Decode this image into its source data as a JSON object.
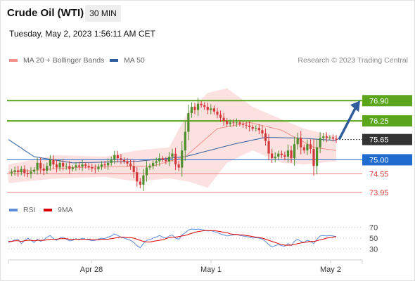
{
  "header": {
    "title": "Crude Oil (WTI)",
    "timeframe": "30 MIN",
    "datetime": "Tuesday, May 2, 2023 1:56:11 AM CET"
  },
  "legend": {
    "ma20": "MA 20 + Bollinger Bands",
    "ma50": "MA 50",
    "credit": "Research © 2023 Trading Central",
    "rsi": "RSI",
    "ma9": "9MA"
  },
  "colors": {
    "ma20": "#f4908a",
    "ma50": "#2f5c9a",
    "bollinger_fill": "#fbdcdc",
    "resistance": "#5aa51c",
    "pivot": "#1f6bd0",
    "support": "#ef7a7a",
    "current": "#333333",
    "candle_up": "#4d8f2a",
    "candle_down": "#d3393b",
    "rsi": "#5b8dd9",
    "rsi_ma": "#e00000"
  },
  "chart_data": [
    {
      "type": "candlestick",
      "ylim": [
        73.7,
        77.2
      ],
      "x_ticks": [
        "Apr 28",
        "May 1",
        "May 2"
      ],
      "levels": [
        {
          "label": "76.90",
          "value": 76.9,
          "role": "resistance"
        },
        {
          "label": "76.25",
          "value": 76.25,
          "role": "resistance"
        },
        {
          "label": "75.65",
          "value": 75.65,
          "role": "current"
        },
        {
          "label": "75.00",
          "value": 75.0,
          "role": "pivot"
        },
        {
          "label": "74.55",
          "value": 74.55,
          "role": "support"
        },
        {
          "label": "73.95",
          "value": 73.95,
          "role": "support"
        }
      ],
      "projection": {
        "from": 75.65,
        "to": 76.9
      },
      "price_path": [
        74.57,
        74.61,
        74.66,
        74.6,
        74.7,
        74.58,
        74.55,
        74.62,
        74.68,
        74.9,
        74.72,
        74.65,
        74.8,
        75.0,
        74.85,
        74.75,
        74.9,
        74.78,
        74.8,
        74.7,
        74.75,
        74.82,
        74.78,
        74.85,
        74.8,
        74.76,
        74.72,
        74.7,
        74.78,
        74.85,
        74.82,
        74.9,
        75.0,
        75.15,
        75.05,
        75.0,
        74.95,
        74.88,
        74.8,
        74.6,
        74.3,
        74.2,
        74.5,
        74.75,
        74.8,
        74.9,
        74.95,
        75.05,
        75.0,
        74.95,
        75.1,
        75.2,
        74.85,
        74.75,
        75.3,
        75.9,
        76.5,
        76.7,
        76.6,
        76.8,
        76.75,
        76.7,
        76.6,
        76.65,
        76.55,
        76.45,
        76.35,
        76.25,
        76.15,
        76.2,
        76.18,
        76.2,
        76.15,
        76.12,
        76.1,
        76.05,
        76.0,
        76.02,
        75.95,
        75.85,
        75.6,
        75.2,
        75.05,
        75.1,
        75.2,
        75.15,
        75.1,
        75.3,
        75.05,
        75.5,
        75.7,
        75.4,
        75.3,
        75.5,
        75.35,
        74.8,
        75.4,
        75.7,
        75.75,
        75.7,
        75.72,
        75.68,
        75.65
      ],
      "ma20": [
        [
          0,
          74.6
        ],
        [
          20,
          74.75
        ],
        [
          45,
          74.8
        ],
        [
          55,
          75.1
        ],
        [
          65,
          76.0
        ],
        [
          75,
          76.2
        ],
        [
          85,
          75.95
        ],
        [
          95,
          75.4
        ],
        [
          102,
          75.3
        ]
      ],
      "ma50": [
        [
          0,
          75.65
        ],
        [
          8,
          75.1
        ],
        [
          20,
          74.9
        ],
        [
          40,
          74.95
        ],
        [
          55,
          75.1
        ],
        [
          70,
          75.5
        ],
        [
          80,
          75.72
        ],
        [
          90,
          75.7
        ],
        [
          102,
          75.62
        ]
      ],
      "bollinger_upper": [
        [
          0,
          74.85
        ],
        [
          15,
          75.15
        ],
        [
          30,
          75.1
        ],
        [
          40,
          75.3
        ],
        [
          50,
          75.4
        ],
        [
          56,
          76.55
        ],
        [
          62,
          77.15
        ],
        [
          68,
          77.3
        ],
        [
          76,
          76.7
        ],
        [
          85,
          76.3
        ],
        [
          92,
          76.0
        ],
        [
          102,
          75.75
        ]
      ],
      "bollinger_lower": [
        [
          0,
          74.25
        ],
        [
          15,
          74.4
        ],
        [
          30,
          74.45
        ],
        [
          40,
          74.3
        ],
        [
          50,
          74.4
        ],
        [
          56,
          74.3
        ],
        [
          62,
          74.1
        ],
        [
          68,
          74.9
        ],
        [
          76,
          75.3
        ],
        [
          85,
          74.9
        ],
        [
          92,
          74.85
        ],
        [
          102,
          74.95
        ]
      ]
    },
    {
      "type": "line",
      "ylim": [
        20,
        80
      ],
      "y_ticks": [
        70,
        50,
        30
      ],
      "series": [
        {
          "name": "RSI",
          "values": [
            42,
            44,
            47,
            48,
            40,
            45,
            50,
            46,
            42,
            48,
            44,
            47,
            52,
            55,
            49,
            46,
            50,
            52,
            48,
            45,
            46,
            49,
            47,
            50,
            48,
            47,
            45,
            46,
            48,
            50,
            49,
            52,
            54,
            58,
            55,
            52,
            50,
            48,
            46,
            42,
            36,
            32,
            40,
            46,
            47,
            50,
            52,
            55,
            52,
            50,
            54,
            56,
            50,
            48,
            56,
            60,
            65,
            67,
            66,
            67,
            66,
            65,
            63,
            64,
            62,
            60,
            58,
            56,
            54,
            55,
            56,
            57,
            55,
            54,
            53,
            52,
            50,
            51,
            50,
            48,
            44,
            38,
            34,
            36,
            38,
            36,
            35,
            40,
            36,
            44,
            48,
            44,
            42,
            46,
            44,
            40,
            48,
            54,
            55,
            54,
            55,
            54,
            53
          ]
        },
        {
          "name": "9MA",
          "values": [
            44,
            44,
            45,
            45,
            44,
            45,
            46,
            46,
            45,
            46,
            46,
            46,
            47,
            48,
            48,
            48,
            49,
            49,
            49,
            48,
            48,
            48,
            48,
            48,
            48,
            48,
            47,
            47,
            47,
            48,
            48,
            48,
            49,
            50,
            51,
            52,
            52,
            51,
            51,
            50,
            48,
            46,
            44,
            43,
            43,
            44,
            45,
            46,
            47,
            49,
            51,
            52,
            52,
            53,
            54,
            55,
            57,
            59,
            61,
            62,
            63,
            64,
            64,
            64,
            64,
            63,
            62,
            61,
            60,
            58,
            57,
            57,
            56,
            56,
            55,
            54,
            53,
            52,
            51,
            50,
            48,
            46,
            44,
            42,
            40,
            38,
            37,
            37,
            37,
            38,
            40,
            41,
            42,
            43,
            44,
            44,
            45,
            47,
            48,
            50,
            51,
            52,
            53
          ]
        }
      ]
    }
  ]
}
